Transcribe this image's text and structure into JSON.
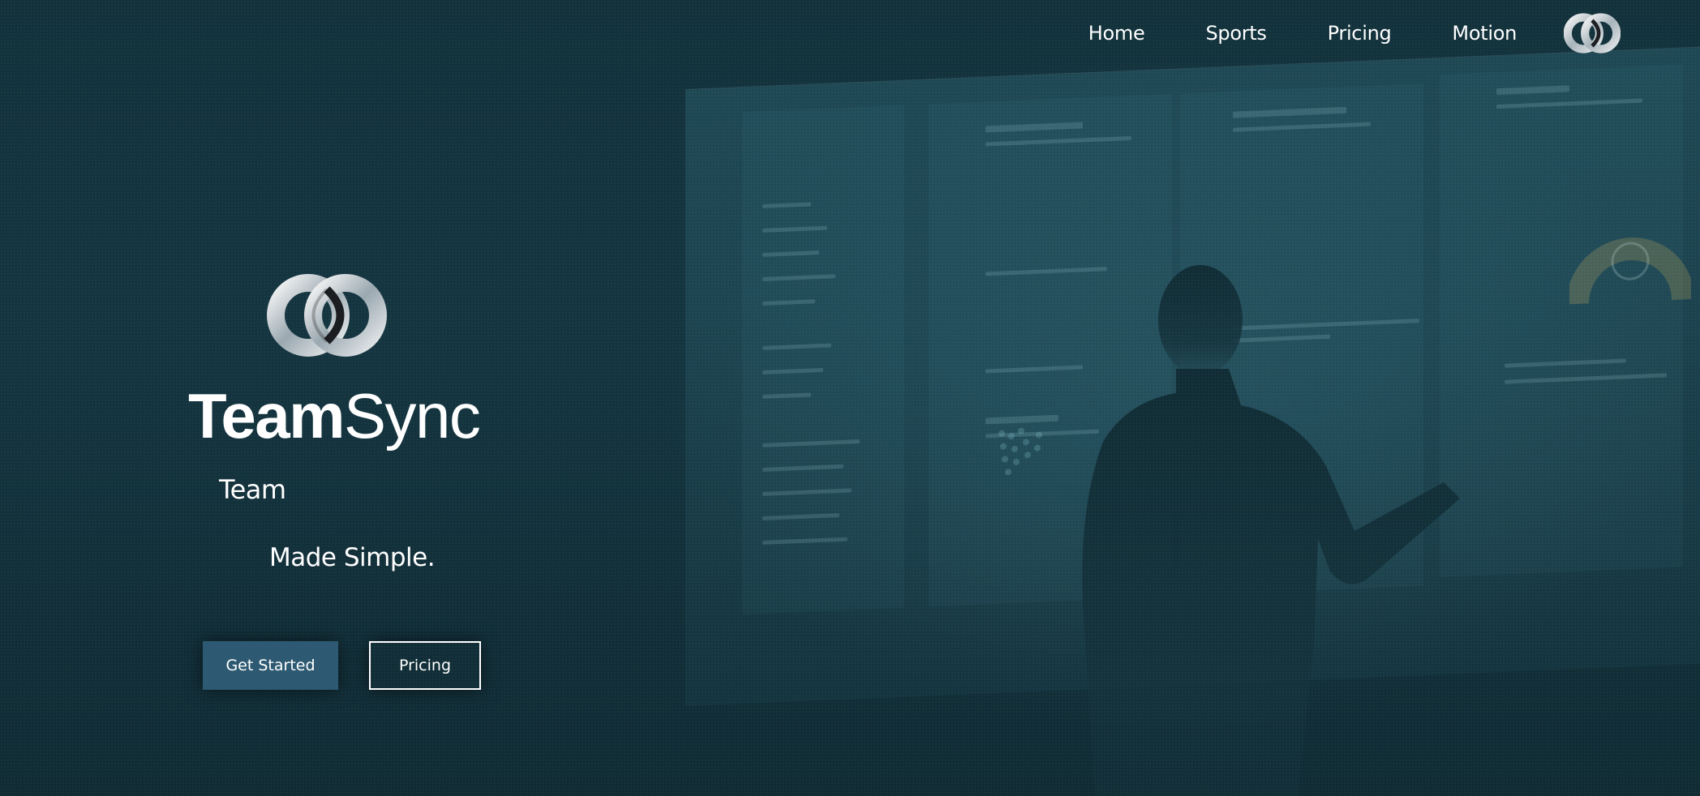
{
  "nav": {
    "links": [
      "Home",
      "Sports",
      "Pricing",
      "Motion"
    ],
    "logo_icon": "teamsync-logo-icon"
  },
  "hero": {
    "brand_bold": "Team",
    "brand_light": "Sync",
    "tagline_line1": "Team",
    "tagline_line2": "Made Simple.",
    "primary_button": "Get Started",
    "secondary_button": "Pricing"
  },
  "colors": {
    "background": "#102a33",
    "primary_button": "#2d5a72",
    "text": "#ffffff"
  }
}
